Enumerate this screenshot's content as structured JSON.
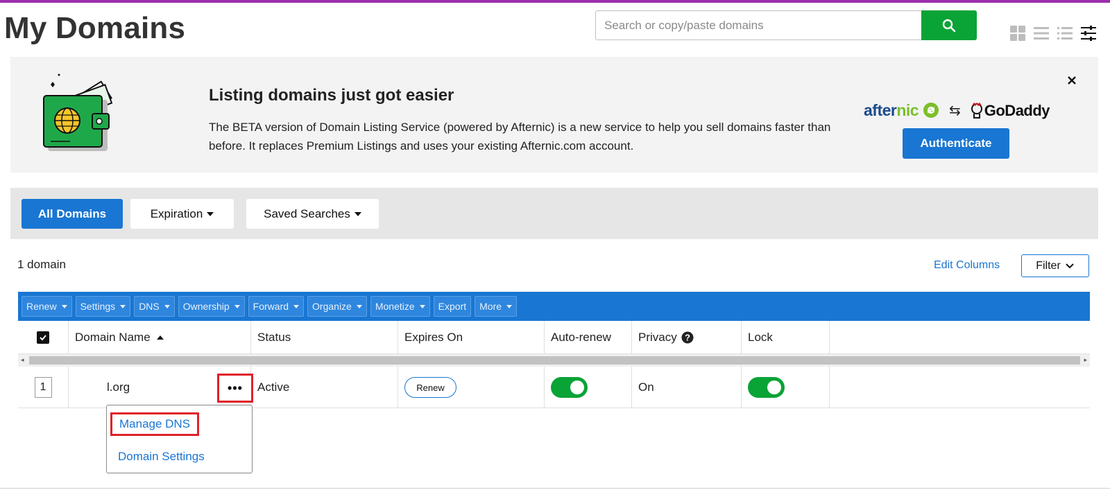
{
  "page": {
    "title": "My Domains"
  },
  "search": {
    "placeholder": "Search or copy/paste domains"
  },
  "view_icons": [
    "grid-view-icon",
    "list-view-icon",
    "bullet-list-view-icon",
    "settings-sliders-icon"
  ],
  "banner": {
    "title": "Listing domains just got easier",
    "text": "The BETA version of Domain Listing Service (powered by Afternic) is a new service to help you sell domains faster than before. It replaces Premium Listings and uses your existing Afternic.com account.",
    "logo_afternic_a": "after",
    "logo_afternic_b": "nic",
    "swap_glyph": "⇆",
    "logo_godaddy": "GoDaddy",
    "button": "Authenticate"
  },
  "filters": {
    "all": "All Domains",
    "expiration": "Expiration",
    "saved": "Saved Searches"
  },
  "summary": {
    "count": "1 domain",
    "edit_columns": "Edit Columns",
    "filter": "Filter"
  },
  "actions": [
    "Renew",
    "Settings",
    "DNS",
    "Ownership",
    "Forward",
    "Organize",
    "Monetize",
    "Export",
    "More"
  ],
  "actions_with_caret": [
    true,
    true,
    true,
    true,
    true,
    true,
    true,
    false,
    true
  ],
  "columns": {
    "domain": "Domain Name",
    "status": "Status",
    "expires": "Expires On",
    "autorenew": "Auto-renew",
    "privacy": "Privacy",
    "lock": "Lock"
  },
  "row": {
    "number": "1",
    "domain": "l.org",
    "more": "•••",
    "status": "Active",
    "renew": "Renew",
    "autorenew_on": true,
    "privacy": "On",
    "lock_on": true
  },
  "menu": {
    "manage_dns": "Manage DNS",
    "domain_settings": "Domain Settings"
  },
  "colors": {
    "accent_blue": "#1976d2",
    "search_green": "#09a336",
    "highlight_red": "#e0202a",
    "top_bar_purple": "#9b2fae"
  }
}
